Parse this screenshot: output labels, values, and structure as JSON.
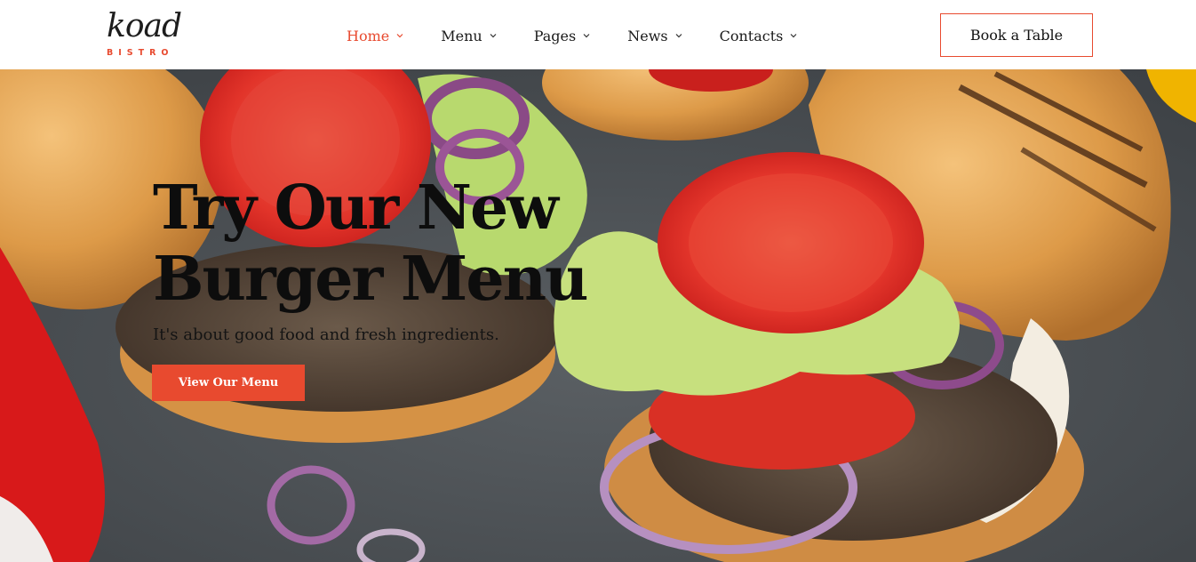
{
  "brand": {
    "name": "koad",
    "sub": "BISTRO",
    "accent": "#e84a2f"
  },
  "nav": {
    "items": [
      {
        "label": "Home",
        "active": true
      },
      {
        "label": "Menu",
        "active": false
      },
      {
        "label": "Pages",
        "active": false
      },
      {
        "label": "News",
        "active": false
      },
      {
        "label": "Contacts",
        "active": false
      }
    ],
    "cta": "Book a Table",
    "dropdown_icon": "chevron-down-icon"
  },
  "hero": {
    "title_line1": "Try Our New",
    "title_line2": "Burger Menu",
    "subtitle": "It's about good food and fresh ingredients.",
    "button": "View Our Menu"
  }
}
